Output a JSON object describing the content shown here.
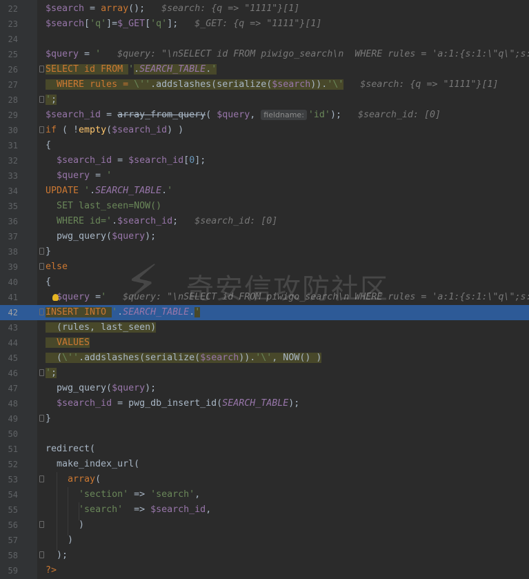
{
  "editor": {
    "language": "php",
    "watermark": {
      "text": "奇安信攻防社区",
      "logo_icon": "lightning-bolt-icon"
    },
    "lines": [
      {
        "n": "22",
        "segments": [
          [
            "var",
            "$search"
          ],
          [
            "txt",
            " = "
          ],
          [
            "kw",
            "array"
          ],
          [
            "txt",
            "();   "
          ],
          [
            "hint",
            "$search: {q => \"1111\"}[1]"
          ]
        ]
      },
      {
        "n": "23",
        "segments": [
          [
            "var",
            "$search"
          ],
          [
            "txt",
            "["
          ],
          [
            "str",
            "'q'"
          ],
          [
            "txt",
            "]="
          ],
          [
            "var",
            "$_GET"
          ],
          [
            "txt",
            "["
          ],
          [
            "str",
            "'q'"
          ],
          [
            "txt",
            "];   "
          ],
          [
            "hint",
            "$_GET: {q => \"1111\"}[1]"
          ]
        ]
      },
      {
        "n": "24",
        "segments": []
      },
      {
        "n": "25",
        "segments": [
          [
            "var",
            "$query"
          ],
          [
            "txt",
            " = "
          ],
          [
            "str",
            "'"
          ],
          [
            "hint",
            "   $query: \"\\nSELECT id FROM piwigo_search\\n  WHERE rules = 'a:1:{s:1:\\\"q\\\";s:"
          ]
        ]
      },
      {
        "n": "26",
        "segments": [
          [
            "sql-kw",
            "SELECT id FROM "
          ],
          [
            "str",
            "'"
          ],
          [
            "txt",
            "."
          ],
          [
            "con",
            "SEARCH_TABLE"
          ],
          [
            "txt",
            "."
          ],
          [
            "sql-str",
            "'"
          ]
        ],
        "sql": true
      },
      {
        "n": "27",
        "segments": [
          [
            "sql-kw",
            "  WHERE rules = "
          ],
          [
            "sql-str",
            "\\''"
          ],
          [
            "txt",
            ".addslashes(serialize("
          ],
          [
            "var",
            "$search"
          ],
          [
            "txt",
            "))."
          ],
          [
            "sql-str",
            "'\\'"
          ],
          [
            "hint",
            "   $search: {q => \"1111\"}[1]"
          ]
        ],
        "sql": true
      },
      {
        "n": "28",
        "segments": [
          [
            "sql-str",
            "'"
          ],
          [
            "txt",
            ";"
          ]
        ],
        "sql": true
      },
      {
        "n": "29",
        "segments": [
          [
            "var",
            "$search_id"
          ],
          [
            "txt",
            " = "
          ],
          [
            "dep",
            "array_from_query"
          ],
          [
            "txt",
            "( "
          ],
          [
            "var",
            "$query"
          ],
          [
            "txt",
            ", "
          ],
          [
            "badge",
            "fieldname:"
          ],
          [
            "str",
            "'id'"
          ],
          [
            "txt",
            ");   "
          ],
          [
            "hint",
            "$search_id: [0]"
          ]
        ]
      },
      {
        "n": "30",
        "segments": [
          [
            "kw",
            "if"
          ],
          [
            "txt",
            " ( !"
          ],
          [
            "fn",
            "empty"
          ],
          [
            "txt",
            "("
          ],
          [
            "var",
            "$search_id"
          ],
          [
            "txt",
            ") )"
          ]
        ]
      },
      {
        "n": "31",
        "segments": [
          [
            "txt",
            "{"
          ]
        ]
      },
      {
        "n": "32",
        "segments": [
          [
            "txt",
            "  "
          ],
          [
            "var",
            "$search_id"
          ],
          [
            "txt",
            " = "
          ],
          [
            "var",
            "$search_id"
          ],
          [
            "txt",
            "["
          ],
          [
            "num",
            "0"
          ],
          [
            "txt",
            "];"
          ]
        ]
      },
      {
        "n": "33",
        "segments": [
          [
            "txt",
            "  "
          ],
          [
            "var",
            "$query"
          ],
          [
            "txt",
            " = "
          ],
          [
            "str",
            "'"
          ]
        ]
      },
      {
        "n": "34",
        "segments": [
          [
            "kw",
            "UPDATE "
          ],
          [
            "str",
            "'"
          ],
          [
            "txt",
            "."
          ],
          [
            "con",
            "SEARCH_TABLE"
          ],
          [
            "txt",
            "."
          ],
          [
            "str",
            "'"
          ]
        ]
      },
      {
        "n": "35",
        "segments": [
          [
            "str",
            "  SET last_seen=NOW()"
          ]
        ]
      },
      {
        "n": "36",
        "segments": [
          [
            "str",
            "  WHERE id='"
          ],
          [
            "txt",
            "."
          ],
          [
            "var",
            "$search_id"
          ],
          [
            "txt",
            ";   "
          ],
          [
            "hint",
            "$search_id: [0]"
          ]
        ]
      },
      {
        "n": "37",
        "segments": [
          [
            "txt",
            "  pwg_query("
          ],
          [
            "var",
            "$query"
          ],
          [
            "txt",
            ");"
          ]
        ]
      },
      {
        "n": "38",
        "segments": [
          [
            "txt",
            "}"
          ]
        ]
      },
      {
        "n": "39",
        "segments": [
          [
            "kw",
            "else"
          ]
        ]
      },
      {
        "n": "40",
        "segments": [
          [
            "txt",
            "{"
          ]
        ]
      },
      {
        "n": "41",
        "segments": [
          [
            "txt",
            "  "
          ],
          [
            "var",
            "$query"
          ],
          [
            "txt",
            " ="
          ],
          [
            "str",
            "'"
          ],
          [
            "hint",
            "   $query: \"\\nSELECT id FROM piwigo_search\\n WHERE rules = 'a:1:{s:1:\\\"q\\\";s:"
          ]
        ],
        "bulb": true
      },
      {
        "n": "42",
        "segments": [
          [
            "sql-kw",
            "INSERT INTO "
          ],
          [
            "str",
            "'"
          ],
          [
            "txt",
            "."
          ],
          [
            "con",
            "SEARCH_TABLE"
          ],
          [
            "txt",
            "."
          ],
          [
            "sql-str",
            "'"
          ]
        ],
        "current": true
      },
      {
        "n": "43",
        "segments": [
          [
            "sql-txt",
            "  (rules, last_seen)"
          ]
        ],
        "sql": true
      },
      {
        "n": "44",
        "segments": [
          [
            "sql-kw",
            "  VALUES"
          ]
        ],
        "sql": true
      },
      {
        "n": "45",
        "segments": [
          [
            "sql-txt",
            "  ("
          ],
          [
            "sql-str",
            "\\''"
          ],
          [
            "txt",
            ".addslashes(serialize("
          ],
          [
            "var",
            "$search"
          ],
          [
            "txt",
            "))."
          ],
          [
            "sql-str",
            "'\\'"
          ],
          [
            "sql-txt",
            ", NOW() )"
          ]
        ],
        "sql": true
      },
      {
        "n": "46",
        "segments": [
          [
            "sql-str",
            "'"
          ],
          [
            "txt",
            ";"
          ]
        ],
        "sql": true
      },
      {
        "n": "47",
        "segments": [
          [
            "txt",
            "  pwg_query("
          ],
          [
            "var",
            "$query"
          ],
          [
            "txt",
            ");"
          ]
        ]
      },
      {
        "n": "48",
        "segments": [
          [
            "txt",
            "  "
          ],
          [
            "var",
            "$search_id"
          ],
          [
            "txt",
            " = pwg_db_insert_id("
          ],
          [
            "con",
            "SEARCH_TABLE"
          ],
          [
            "txt",
            ");"
          ]
        ]
      },
      {
        "n": "49",
        "segments": [
          [
            "txt",
            "}"
          ]
        ]
      },
      {
        "n": "50",
        "segments": []
      },
      {
        "n": "51",
        "segments": [
          [
            "txt",
            "redirect("
          ]
        ]
      },
      {
        "n": "52",
        "segments": [
          [
            "txt",
            "  make_index_url("
          ]
        ]
      },
      {
        "n": "53",
        "segments": [
          [
            "txt",
            "    "
          ],
          [
            "kw",
            "array"
          ],
          [
            "txt",
            "("
          ]
        ]
      },
      {
        "n": "54",
        "segments": [
          [
            "txt",
            "      "
          ],
          [
            "str",
            "'section'"
          ],
          [
            "txt",
            " => "
          ],
          [
            "str",
            "'search'"
          ],
          [
            "txt",
            ","
          ]
        ]
      },
      {
        "n": "55",
        "segments": [
          [
            "txt",
            "      "
          ],
          [
            "str",
            "'search'"
          ],
          [
            "txt",
            "  => "
          ],
          [
            "var",
            "$search_id"
          ],
          [
            "txt",
            ","
          ]
        ]
      },
      {
        "n": "56",
        "segments": [
          [
            "txt",
            "      )"
          ]
        ]
      },
      {
        "n": "57",
        "segments": [
          [
            "txt",
            "    )"
          ]
        ]
      },
      {
        "n": "58",
        "segments": [
          [
            "txt",
            "  );"
          ]
        ]
      },
      {
        "n": "59",
        "segments": [
          [
            "kw",
            "?>"
          ]
        ]
      }
    ]
  }
}
